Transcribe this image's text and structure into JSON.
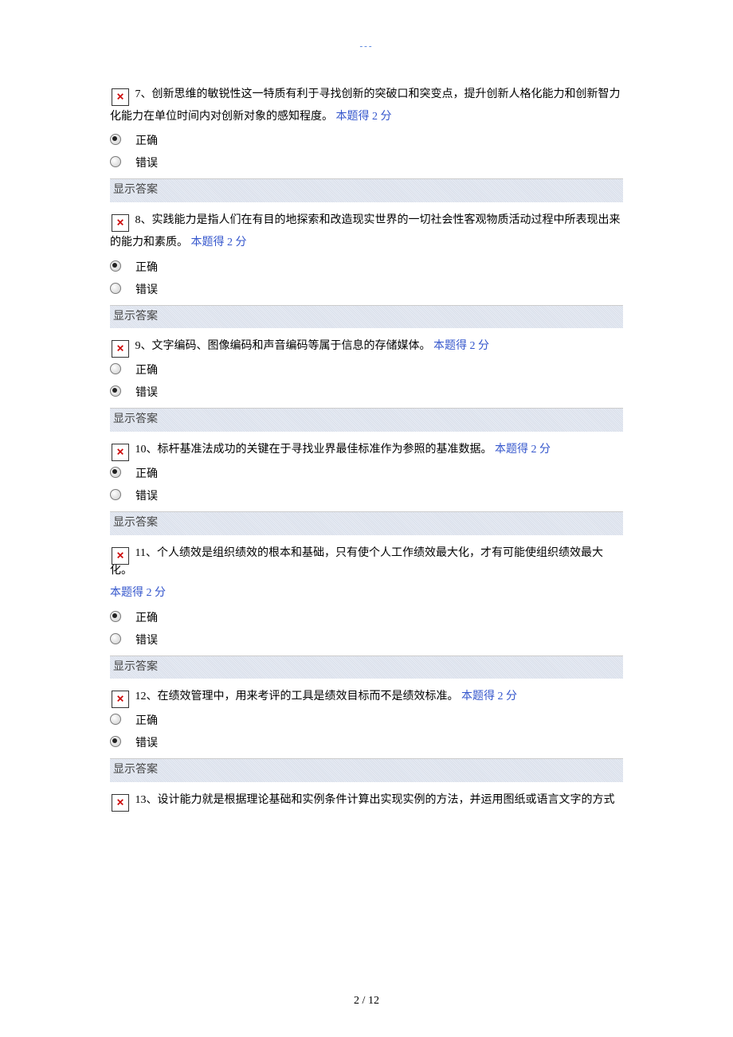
{
  "header_dots": "---",
  "score_label": "  本题得 2 分",
  "option_true": "正确",
  "option_false": "错误",
  "show_answer": "显示答案",
  "questions": [
    {
      "num": "7、",
      "line1": "创新思维的敏锐性这一特质有利于寻找创新的突破口和突变点，提升创新人格化能力和创新智力",
      "rest": "化能力在单位时间内对创新对象的感知程度。",
      "selected": "true"
    },
    {
      "num": "8、",
      "line1": "实践能力是指人们在有目的地探索和改造现实世界的一切社会性客观物质活动过程中所表现出来",
      "rest": "的能力和素质。",
      "selected": "true"
    },
    {
      "num": "9、",
      "line1": "文字编码、图像编码和声音编码等属于信息的存储媒体。",
      "rest": "",
      "selected": "false"
    },
    {
      "num": "10、",
      "line1": "标杆基准法成功的关键在于寻找业界最佳标准作为参照的基准数据。",
      "rest": "",
      "selected": "true"
    },
    {
      "num": "11、",
      "line1": "个人绩效是组织绩效的根本和基础，只有使个人工作绩效最大化，才有可能使组织绩效最大化。",
      "rest": "",
      "score_on_new_line": true,
      "selected": "true"
    },
    {
      "num": "12、",
      "line1": "在绩效管理中，用来考评的工具是绩效目标而不是绩效标准。",
      "rest": "",
      "selected": "false"
    },
    {
      "num": "13、",
      "line1": "设计能力就是根据理论基础和实例条件计算出实现实例的方法，并运用图纸或语言文字的方式",
      "rest": "",
      "no_options": true
    }
  ],
  "footer": {
    "page": "2",
    "sep": " / ",
    "total": "12"
  }
}
